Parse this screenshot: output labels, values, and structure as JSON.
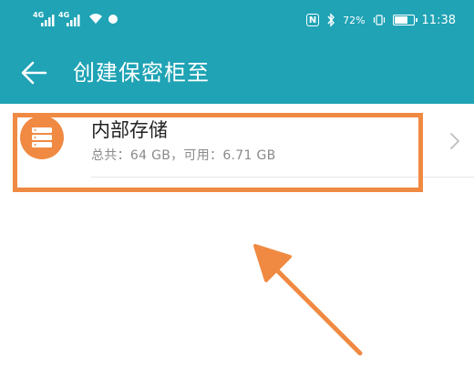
{
  "colors": {
    "header_bg": "#1fa3b5",
    "accent_orange": "#f08a42",
    "text_primary": "#222222",
    "text_secondary": "#8a8a8a",
    "background": "#ffffff"
  },
  "status_bar": {
    "signal1_label": "4G",
    "signal2_label": "4G",
    "nfc_label": "N",
    "battery_percent": "72%",
    "battery_level": 0.72,
    "time": "11:38",
    "icons": [
      "signal-icon",
      "wifi-icon",
      "nfc-icon",
      "bluetooth-icon",
      "vibrate-icon",
      "battery-icon"
    ]
  },
  "title_bar": {
    "back_icon": "back-arrow-icon",
    "title": "创建保密柜至"
  },
  "storage_list": [
    {
      "icon": "storage-icon",
      "name": "内部存储",
      "detail": "总共：64 GB，可用：6.71 GB",
      "chevron_icon": "chevron-right-icon"
    }
  ],
  "annotations": {
    "highlight_color": "#f08a42",
    "arrow_icon": "pointer-arrow-icon"
  }
}
